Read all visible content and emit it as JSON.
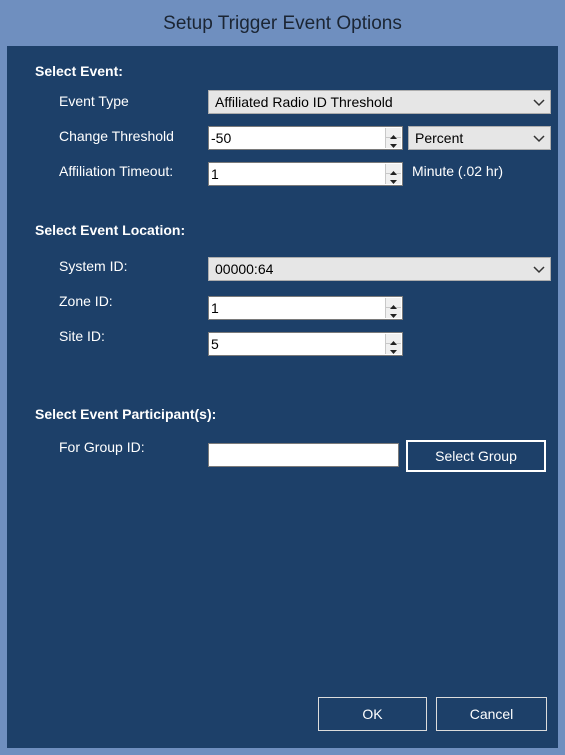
{
  "window": {
    "title": "Setup Trigger Event Options"
  },
  "select_event": {
    "heading": "Select Event:",
    "event_type": {
      "label": "Event Type",
      "value": "Affiliated Radio ID Threshold"
    },
    "change_threshold": {
      "label": "Change Threshold",
      "value": "-50",
      "unit_value": "Percent"
    },
    "affiliation_timeout": {
      "label": "Affiliation Timeout:",
      "value": "1",
      "note": "Minute (.02 hr)"
    }
  },
  "select_location": {
    "heading": "Select Event Location:",
    "system_id": {
      "label": "System ID:",
      "value": "00000:64"
    },
    "zone_id": {
      "label": "Zone ID:",
      "value": "1"
    },
    "site_id": {
      "label": "Site ID:",
      "value": "5"
    }
  },
  "select_participants": {
    "heading": "Select Event Participant(s):",
    "group_id": {
      "label": "For Group ID:",
      "value": ""
    },
    "select_group_label": "Select Group"
  },
  "footer": {
    "ok_label": "OK",
    "cancel_label": "Cancel"
  },
  "colors": {
    "titlebar": "#6f8fbf",
    "client": "#1d4069",
    "text": "#ffffff"
  },
  "icons": {
    "dropdown": "chevron-down-icon",
    "spinner": "up-down-arrows-icon"
  }
}
